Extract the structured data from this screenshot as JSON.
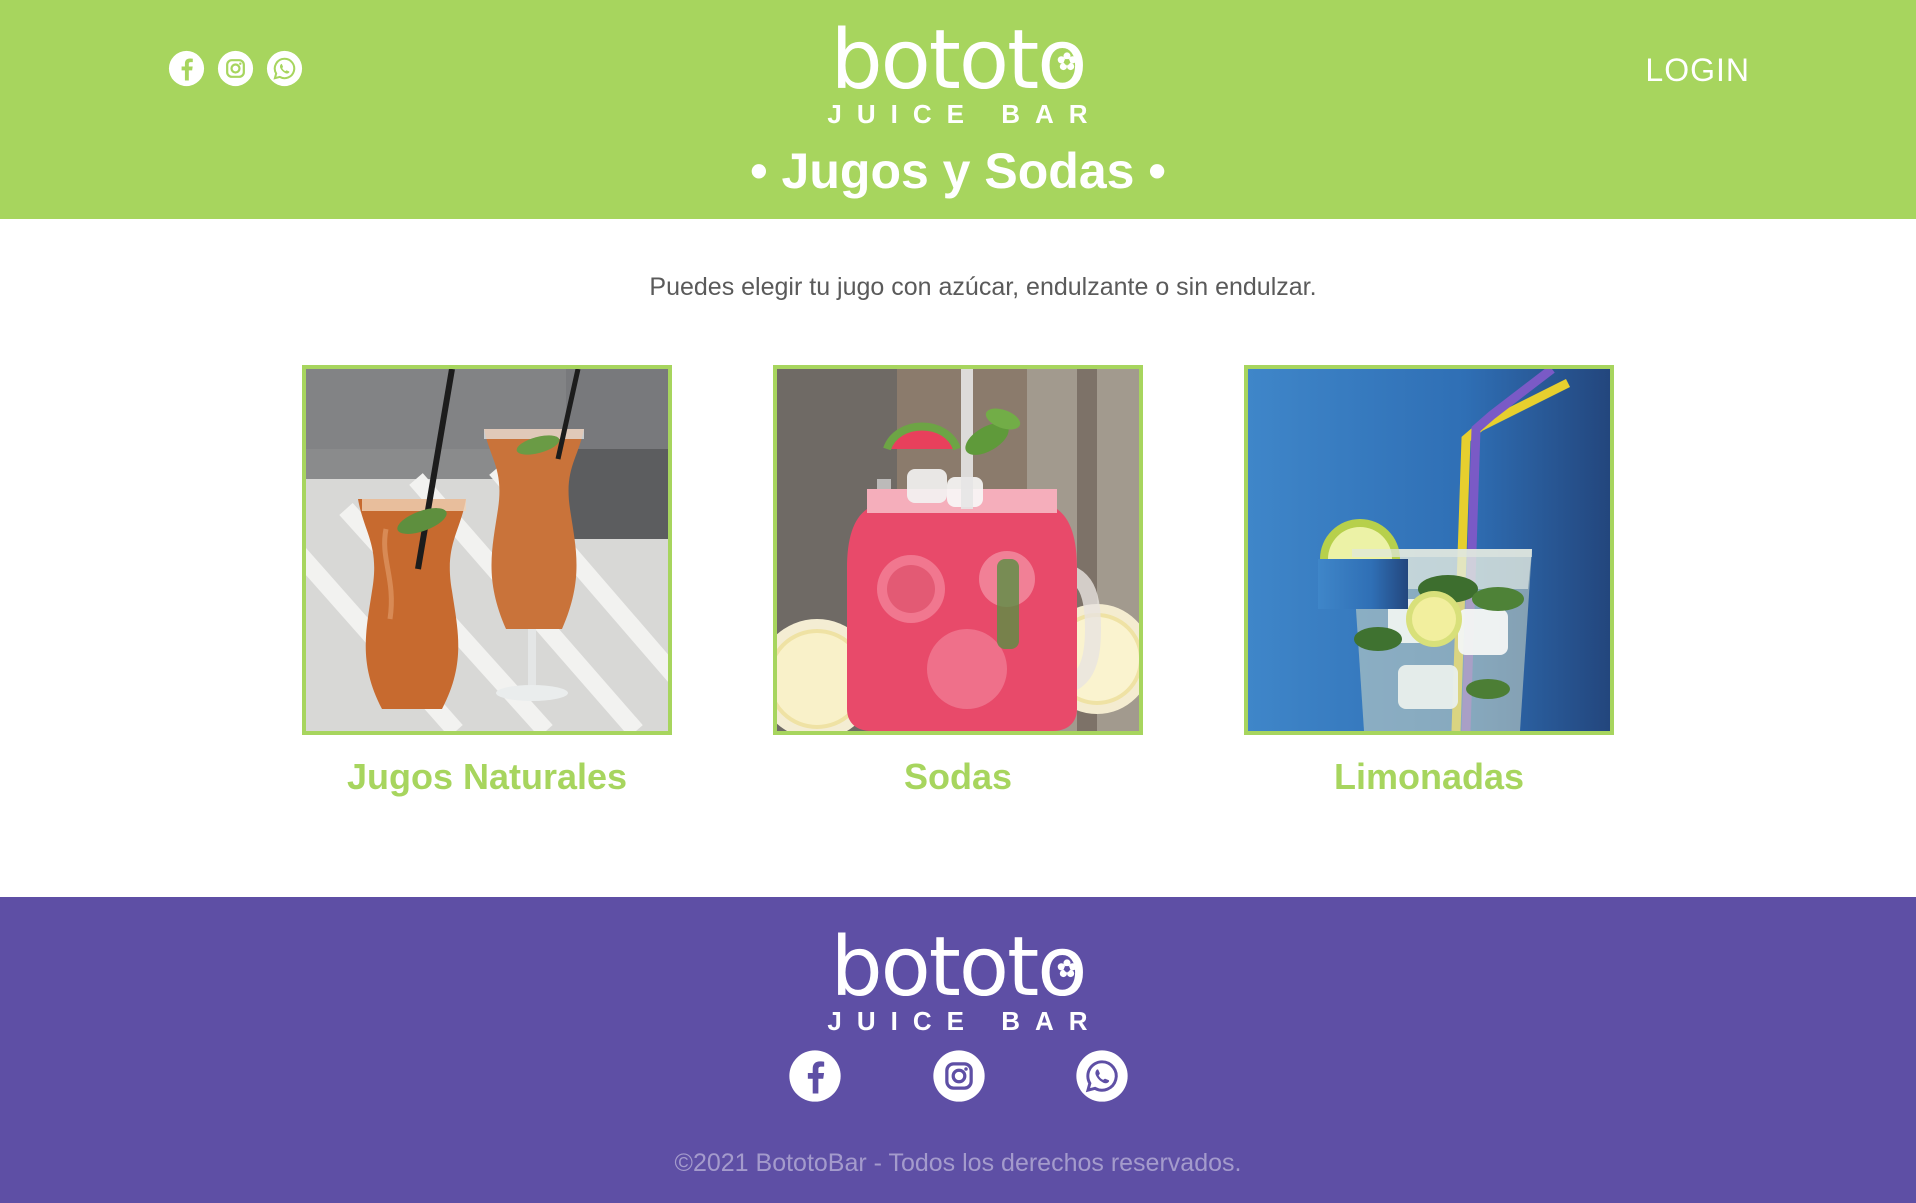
{
  "header": {
    "social": [
      {
        "name": "facebook-icon"
      },
      {
        "name": "instagram-icon"
      },
      {
        "name": "whatsapp-icon"
      }
    ],
    "logo": {
      "word": "bototo",
      "sub": "JUICE BAR"
    },
    "login_label": "LOGIN",
    "page_title": "• Jugos y Sodas •"
  },
  "main": {
    "subtitle": "Puedes elegir tu jugo con azúcar, endulzante o sin endulzar.",
    "cards": [
      {
        "label": "Jugos Naturales",
        "image": "orange-juice-glasses"
      },
      {
        "label": "Sodas",
        "image": "watermelon-soda-jar"
      },
      {
        "label": "Limonadas",
        "image": "lemonade-glass-straws"
      }
    ]
  },
  "footer": {
    "logo": {
      "word": "bototo",
      "sub": "JUICE BAR"
    },
    "social": [
      {
        "name": "facebook-icon"
      },
      {
        "name": "instagram-icon"
      },
      {
        "name": "whatsapp-icon"
      }
    ],
    "copyright": "©2021 BototoBar - Todos los derechos reservados."
  },
  "colors": {
    "brand_green": "#a7d55e",
    "brand_purple": "#5e4fa5",
    "white": "#ffffff",
    "text_gray": "#5a5a5a"
  }
}
